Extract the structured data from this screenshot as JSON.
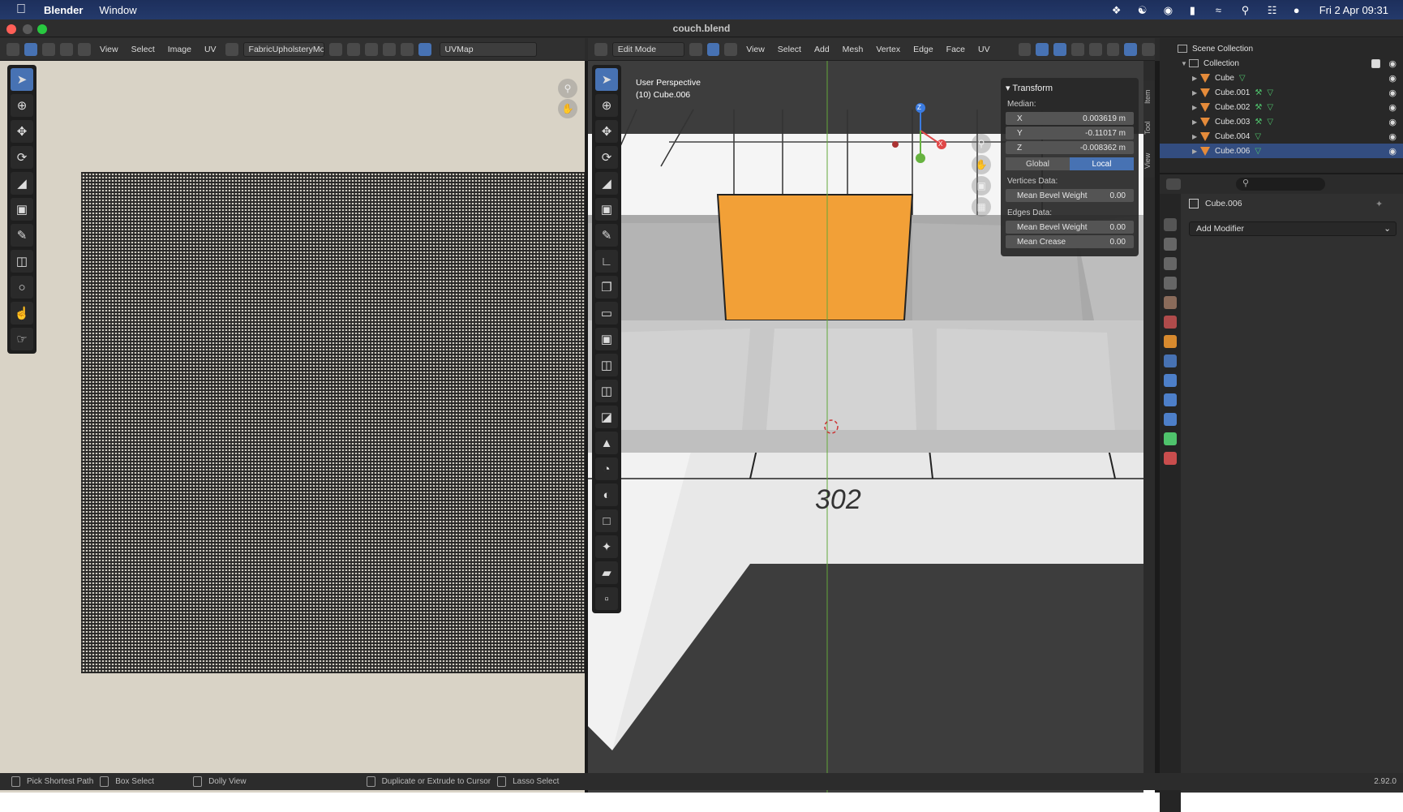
{
  "menubar": {
    "app": "Blender",
    "menu_window": "Window",
    "datetime": "Fri 2 Apr  09:31"
  },
  "window": {
    "title": "couch.blend"
  },
  "uv_header": {
    "menus": [
      "View",
      "Select",
      "Image",
      "UV"
    ],
    "image_name": "FabricUpholsteryMo...",
    "uvmap": "UVMap"
  },
  "vp_header": {
    "mode": "Edit Mode",
    "menus": [
      "View",
      "Select",
      "Add",
      "Mesh",
      "Vertex",
      "Edge",
      "Face",
      "UV"
    ]
  },
  "viewport": {
    "perspective": "User Perspective",
    "object_info": "(10) Cube.006",
    "floor_text": "302",
    "axes": {
      "z": "Z",
      "x": "X"
    }
  },
  "npanel": {
    "title": "Transform",
    "median_label": "Median:",
    "x_label": "X",
    "x_value": "0.003619 m",
    "y_label": "Y",
    "y_value": "-0.11017 m",
    "z_label": "Z",
    "z_value": "-0.008362 m",
    "global": "Global",
    "local": "Local",
    "vertices_label": "Vertices Data:",
    "vert_bevel_label": "Mean Bevel Weight",
    "vert_bevel_value": "0.00",
    "edges_label": "Edges Data:",
    "edge_bevel_label": "Mean Bevel Weight",
    "edge_bevel_value": "0.00",
    "crease_label": "Mean Crease",
    "crease_value": "0.00",
    "tabs": [
      "Item",
      "Tool",
      "View"
    ]
  },
  "outliner": {
    "scene_collection": "Scene Collection",
    "collection": "Collection",
    "objects": [
      "Cube",
      "Cube.001",
      "Cube.002",
      "Cube.003",
      "Cube.004",
      "Cube.006"
    ]
  },
  "properties": {
    "object_name": "Cube.006",
    "add_modifier": "Add Modifier"
  },
  "statusbar": {
    "items": [
      "Pick Shortest Path",
      "Box Select",
      "Dolly View",
      "Duplicate or Extrude to Cursor",
      "Lasso Select"
    ],
    "version": "2.92.0"
  }
}
